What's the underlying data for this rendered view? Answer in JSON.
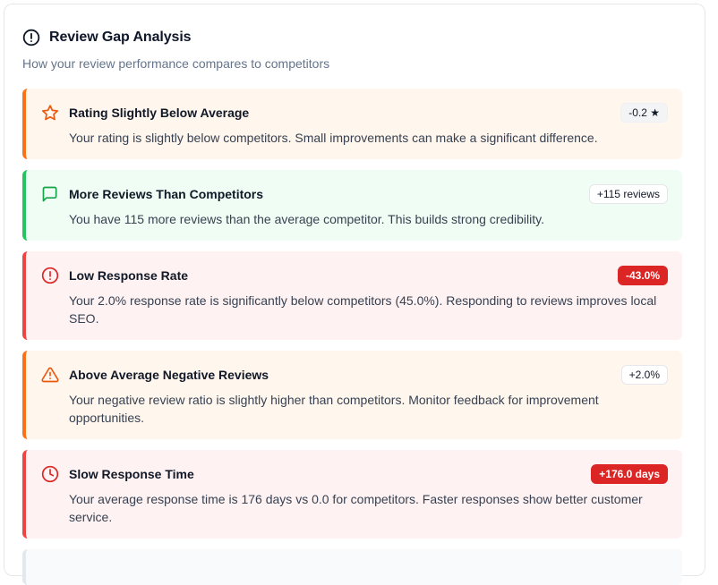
{
  "card": {
    "title": "Review Gap Analysis",
    "subtitle": "How your review performance compares to competitors"
  },
  "items": [
    {
      "title": "Rating Slightly Below Average",
      "description": "Your rating is slightly below competitors. Small improvements can make a significant difference.",
      "badge": "-0.2 ★",
      "icon": "star-icon",
      "tone": "orange"
    },
    {
      "title": "More Reviews Than Competitors",
      "description": "You have 115 more reviews than the average competitor. This builds strong credibility.",
      "badge": "+115 reviews",
      "icon": "message-square-icon",
      "tone": "green"
    },
    {
      "title": "Low Response Rate",
      "description": "Your 2.0% response rate is significantly below competitors (45.0%). Responding to reviews improves local SEO.",
      "badge": "-43.0%",
      "icon": "alert-circle-icon",
      "tone": "red"
    },
    {
      "title": "Above Average Negative Reviews",
      "description": "Your negative review ratio is slightly higher than competitors. Monitor feedback for improvement opportunities.",
      "badge": "+2.0%",
      "icon": "alert-triangle-icon",
      "tone": "orange"
    },
    {
      "title": "Slow Response Time",
      "description": "Your average response time is 176 days vs 0.0 for competitors. Faster responses show better customer service.",
      "badge": "+176.0 days",
      "icon": "clock-icon",
      "tone": "red"
    }
  ],
  "colors": {
    "orange": "#f97316",
    "green": "#22c55e",
    "red": "#ef4444",
    "danger_badge": "#dc2626"
  }
}
